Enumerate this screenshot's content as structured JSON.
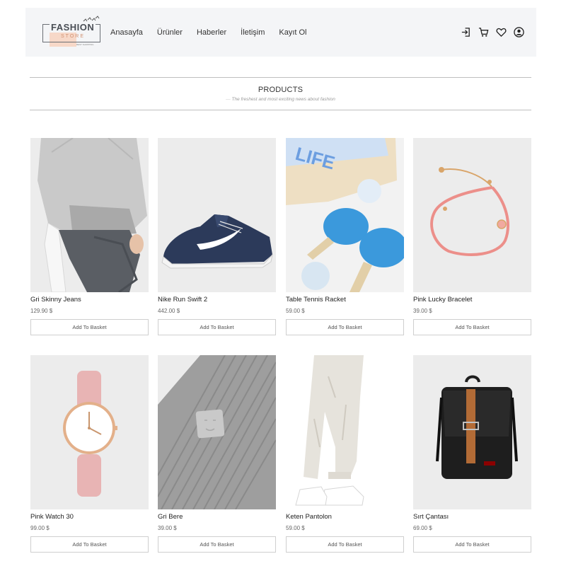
{
  "brand": {
    "logo_text": "FASHION",
    "logo_sub": "STORE",
    "logo_tagline": "BEST SHOPPING"
  },
  "nav": [
    {
      "label": "Anasayfa"
    },
    {
      "label": "Ürünler"
    },
    {
      "label": "Haberler"
    },
    {
      "label": "İletişim"
    },
    {
      "label": "Kayıt Ol"
    }
  ],
  "header_icons": [
    "login-icon",
    "cart-icon",
    "heart-icon",
    "user-icon"
  ],
  "section": {
    "title": "PRODUCTS",
    "subtitle": "The freshest and most exciting news about fashion"
  },
  "products": [
    {
      "name": "Gri Skinny Jeans",
      "price": "129.90 $",
      "button": "Add To Basket",
      "image": "model-jeans"
    },
    {
      "name": "Nike Run Swift 2",
      "price": "442.00 $",
      "button": "Add To Basket",
      "image": "sneaker"
    },
    {
      "name": "Table Tennis Racket",
      "price": "59.00 $",
      "button": "Add To Basket",
      "image": "ping-pong"
    },
    {
      "name": "Pink Lucky Bracelet",
      "price": "39.00 $",
      "button": "Add To Basket",
      "image": "bracelet"
    },
    {
      "name": "Pink Watch 30",
      "price": "99.00 $",
      "button": "Add To Basket",
      "image": "watch"
    },
    {
      "name": "Gri Bere",
      "price": "39.00 $",
      "button": "Add To Basket",
      "image": "beanie"
    },
    {
      "name": "Keten Pantolon",
      "price": "59.00 $",
      "button": "Add To Basket",
      "image": "linen-pants"
    },
    {
      "name": "Sırt Çantası",
      "price": "69.00 $",
      "button": "Add To Basket",
      "image": "backpack"
    }
  ],
  "colors": {
    "header_bg": "#f4f5f7",
    "logo_accent": "#f7d8c8",
    "button_border": "#cfcfcf"
  }
}
